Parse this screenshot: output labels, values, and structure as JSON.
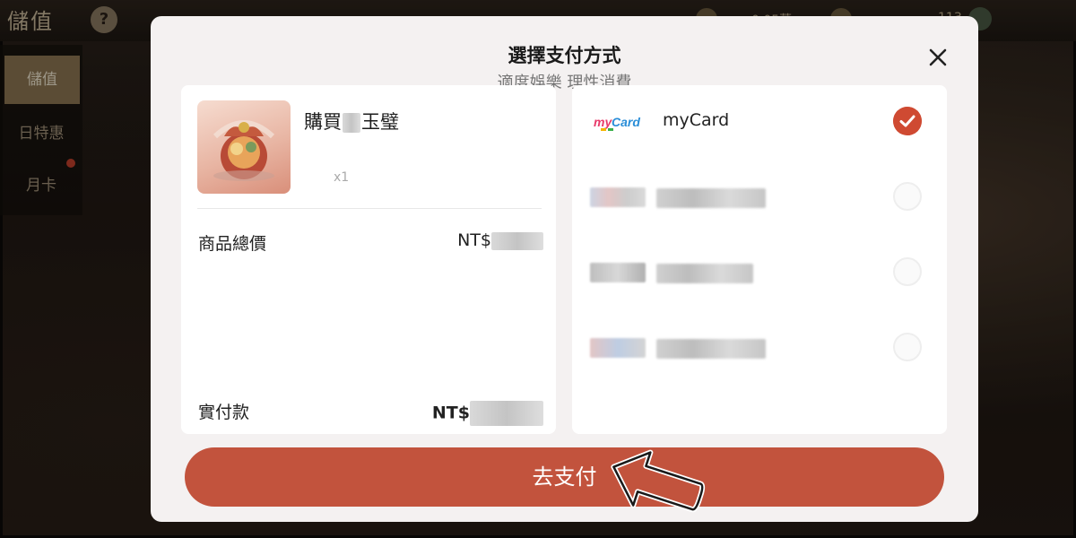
{
  "game": {
    "title": "儲值",
    "help": "?",
    "side_menu": [
      "儲值",
      "日特惠",
      "月卡"
    ],
    "stat_1": "0.05萬",
    "stat_2": "113"
  },
  "modal": {
    "title": "選擇支付方式",
    "subtitle": "適度娛樂 理性消費",
    "close_icon": "close-icon"
  },
  "order": {
    "product_name_prefix": "購買",
    "product_name_suffix": "玉璧",
    "quantity": "x1",
    "total_label": "商品總價",
    "total_currency": "NT$",
    "paid_label": "實付款",
    "paid_currency": "NT$"
  },
  "payment_methods": [
    {
      "name": "myCard",
      "logo": "mycard-logo",
      "selected": true
    },
    {
      "name": "",
      "logo": "blurred-logo",
      "selected": false
    },
    {
      "name": "",
      "logo": "blurred-logo",
      "selected": false
    },
    {
      "name": "",
      "logo": "blurred-logo",
      "selected": false
    }
  ],
  "pay_button": {
    "label": "去支付"
  },
  "colors": {
    "accent": "#c2533d",
    "check": "#cf4a32",
    "modal_bg": "#f4f1f1"
  }
}
